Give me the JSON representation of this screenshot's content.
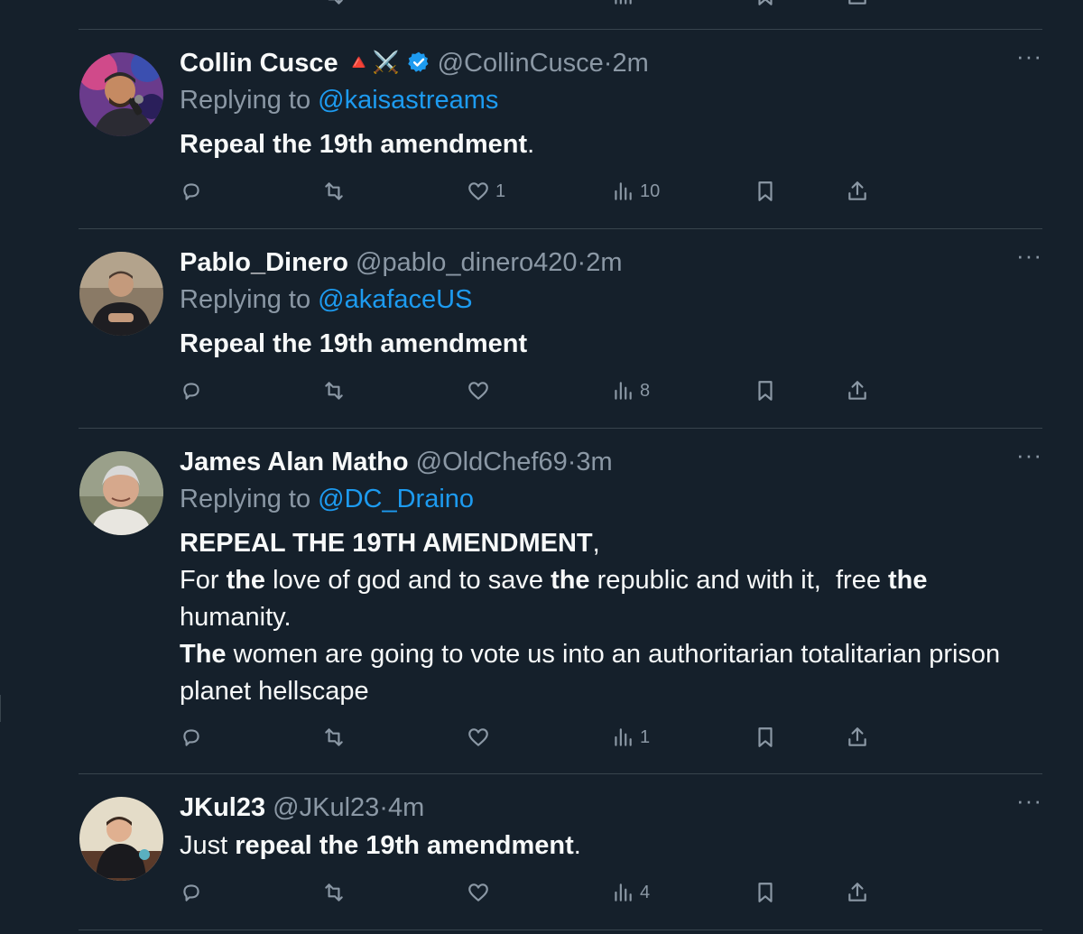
{
  "tweets": [
    {
      "name": "Collin Cusce",
      "badges": "🔺⚔️",
      "handle": "@CollinCusce",
      "time": "2m",
      "replying_label": "Replying to",
      "replying_to": "@kaisastreams",
      "body_bold": "Repeal the 19th amendment",
      "body_tail": ".",
      "replies": "",
      "retweets": "",
      "likes": "1",
      "views": "10"
    },
    {
      "name": "Pablo_Dinero",
      "handle": "@pablo_dinero420",
      "time": "2m",
      "replying_label": "Replying to",
      "replying_to": "@akafaceUS",
      "body_bold": "Repeal the 19th amendment",
      "replies": "",
      "retweets": "",
      "likes": "",
      "views": "8"
    },
    {
      "name": "James Alan Matho",
      "handle": "@OldChef69",
      "time": "3m",
      "replying_label": "Replying to",
      "replying_to": "@DC_Draino",
      "body_line1_bold": "REPEAL THE 19TH AMENDMENT",
      "body_line1_tail": ",",
      "body_line2_a": "For ",
      "body_line2_b": "the",
      "body_line2_c": " love of god and to save ",
      "body_line2_d": "the",
      "body_line2_e": " republic and with it,  free ",
      "body_line2_f": "the",
      "body_line3": "humanity.",
      "body_line4_bold": "The",
      "body_line4_rest": " women are going to vote us into an authoritarian totalitarian prison",
      "body_line5": "planet hellscape",
      "replies": "",
      "retweets": "",
      "likes": "",
      "views": "1"
    },
    {
      "name": "JKul23",
      "handle": "@JKul23",
      "time": "4m",
      "body_prefix": "Just ",
      "body_bold": "repeal the 19th amendment",
      "body_tail": ".",
      "replies": "",
      "retweets": "",
      "likes": "",
      "views": "4"
    }
  ],
  "ui": {
    "more_label": "···",
    "dot": "·"
  },
  "colors": {
    "background": "#15202b",
    "divider": "#38444d",
    "secondary_text": "#8b98a5",
    "link": "#1d9bf0",
    "verified": "#1d9bf0"
  },
  "icons": [
    "reply-icon",
    "retweet-icon",
    "like-icon",
    "views-icon",
    "bookmark-icon",
    "share-icon",
    "verified-badge-icon",
    "more-icon"
  ]
}
